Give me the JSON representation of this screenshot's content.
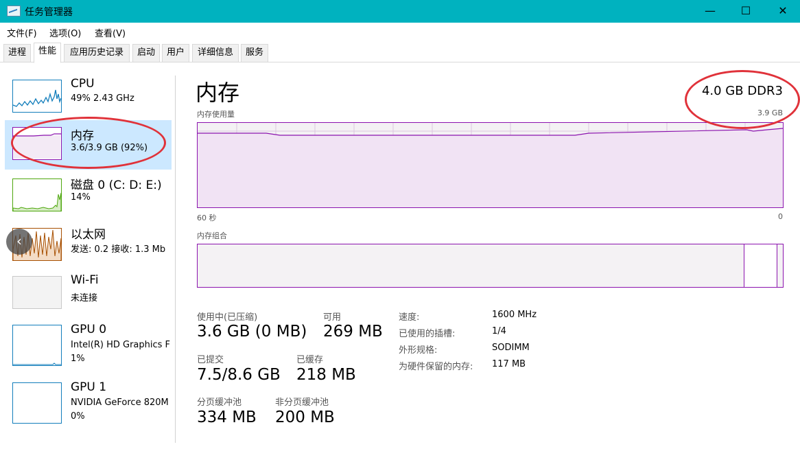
{
  "window": {
    "title": "任务管理器",
    "minimize": "—",
    "maximize": "☐",
    "close": "✕"
  },
  "menu": [
    "文件(F)",
    "选项(O)",
    "查看(V)"
  ],
  "tabs": [
    "进程",
    "性能",
    "应用历史记录",
    "启动",
    "用户",
    "详细信息",
    "服务"
  ],
  "sidebar": {
    "items": [
      {
        "title": "CPU",
        "subtitle": "49% 2.43 GHz"
      },
      {
        "title": "内存",
        "subtitle": "3.6/3.9 GB (92%)"
      },
      {
        "title": "磁盘 0 (C: D: E:)",
        "subtitle": "14%"
      },
      {
        "title": "以太网",
        "subtitle": "发送: 0.2 接收: 1.3 Mb"
      },
      {
        "title": "Wi-Fi",
        "subtitle": "未连接"
      },
      {
        "title": "GPU 0",
        "subtitle": "Intel(R) HD Graphics F",
        "extra": "1%"
      },
      {
        "title": "GPU 1",
        "subtitle": "NVIDIA GeForce 820M",
        "extra": "0%"
      }
    ],
    "nav_arrow": "‹"
  },
  "main": {
    "title": "内存",
    "spec": "4.0 GB DDR3",
    "usage_label": "内存使用量",
    "usage_max": "3.9 GB",
    "axis_left": "60 秒",
    "axis_right": "0",
    "composition_label": "内存组合",
    "stats": [
      {
        "label": "使用中(已压缩)",
        "value": "3.6 GB (0 MB)"
      },
      {
        "label": "可用",
        "value": "269 MB"
      },
      {
        "label": "已提交",
        "value": "7.5/8.6 GB"
      },
      {
        "label": "已缓存",
        "value": "218 MB"
      },
      {
        "label": "分页缓冲池",
        "value": "334 MB"
      },
      {
        "label": "非分页缓冲池",
        "value": "200 MB"
      }
    ],
    "info": [
      {
        "label": "速度:",
        "value": "1600 MHz"
      },
      {
        "label": "已使用的插槽:",
        "value": "1/4"
      },
      {
        "label": "外形规格:",
        "value": "SODIMM"
      },
      {
        "label": "为硬件保留的内存:",
        "value": "117 MB"
      }
    ]
  },
  "colors": {
    "titlebar": "#00b2bf",
    "memory": "#8b12ae",
    "cpu": "#117dbb",
    "disk": "#4da60c",
    "ethernet": "#a74f01",
    "selected": "#cce8ff",
    "annotation": "#e0323a"
  }
}
